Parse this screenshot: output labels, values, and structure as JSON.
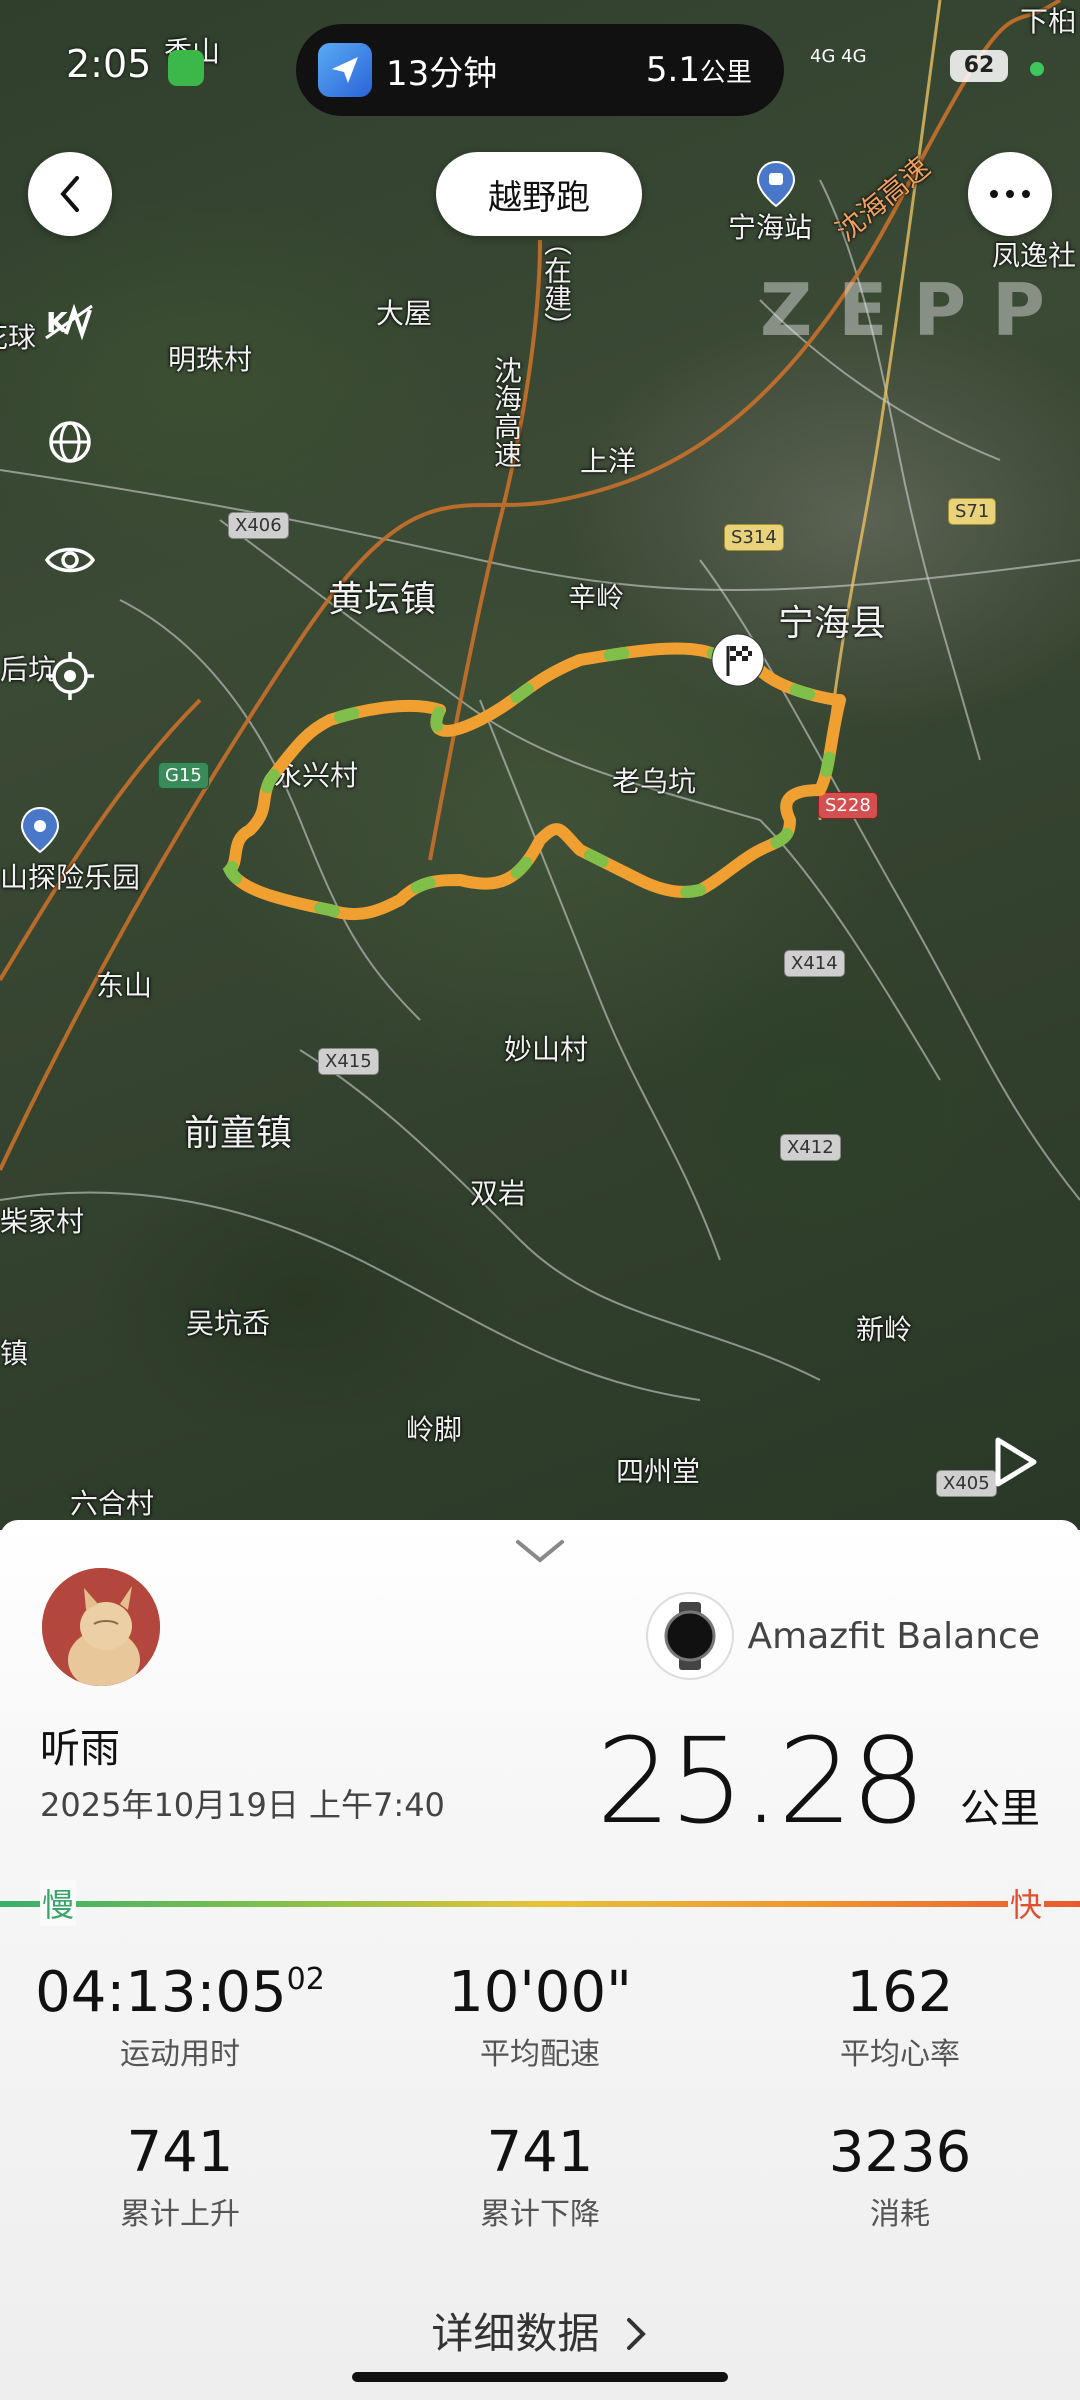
{
  "status_bar": {
    "time": "2:05",
    "nav_duration": "13分钟",
    "nav_distance_value": "5.1",
    "nav_distance_unit": "公里",
    "network": "4G 4G",
    "battery": "62"
  },
  "header": {
    "activity_type": "越野跑",
    "back_icon": "chevron-left-icon",
    "more_icon": "more-dots-icon"
  },
  "map": {
    "watermark": "ZEPP",
    "side_controls": [
      "km-marker-icon",
      "globe-icon",
      "eye-icon",
      "locate-icon"
    ],
    "play_icon": "play-icon",
    "route_color": "#f0a030",
    "places": {
      "xiangshan": "香山",
      "xiazhu": "下桕",
      "dawu": "大屋",
      "mingzhu": "明珠村",
      "huatan": "花球",
      "zaijian": "（在建）",
      "shenhai_vertical": "沈海高速",
      "shangyang": "上洋",
      "ninghai_station": "宁海站",
      "shenhai_gaosu": "沈海高速",
      "fengyi": "凤逸社",
      "huangtan": "黄坛镇",
      "xinling": "辛岭",
      "ninghai_county": "宁海县",
      "houkeng": "后坑",
      "yongxing": "永兴村",
      "laowukeng": "老乌坑",
      "leyuan": "山探险乐园",
      "dongshan": "东山",
      "miaoshan": "妙山村",
      "qiantong": "前童镇",
      "shuangyan": "双岩",
      "chaijia": "柴家村",
      "wukeng": "吴坑岙",
      "xinling2": "新岭",
      "zhen": "镇",
      "lingjiao": "岭脚",
      "sizhoutang": "四州堂",
      "liuhe": "六合村"
    },
    "roads": {
      "x406": "X406",
      "s314": "S314",
      "s71": "S71",
      "g15": "G15",
      "s228": "S228",
      "x414": "X414",
      "x415": "X415",
      "x412": "X412",
      "x405": "X405"
    }
  },
  "summary": {
    "user_name": "听雨",
    "datetime": "2025年10月19日 上午7:40",
    "device_name": "Amazfit Balance",
    "distance_value": "25.28",
    "distance_unit": "公里",
    "pace_slow_label": "慢",
    "pace_fast_label": "快",
    "stats": [
      {
        "value": "04:13:05",
        "sup": "02",
        "label": "运动用时"
      },
      {
        "value": "10'00\"",
        "sup": "",
        "label": "平均配速"
      },
      {
        "value": "162",
        "sup": "",
        "label": "平均心率"
      },
      {
        "value": "741",
        "sup": "",
        "label": "累计上升"
      },
      {
        "value": "741",
        "sup": "",
        "label": "累计下降"
      },
      {
        "value": "3236",
        "sup": "",
        "label": "消耗"
      }
    ],
    "detail_link": "详细数据"
  }
}
